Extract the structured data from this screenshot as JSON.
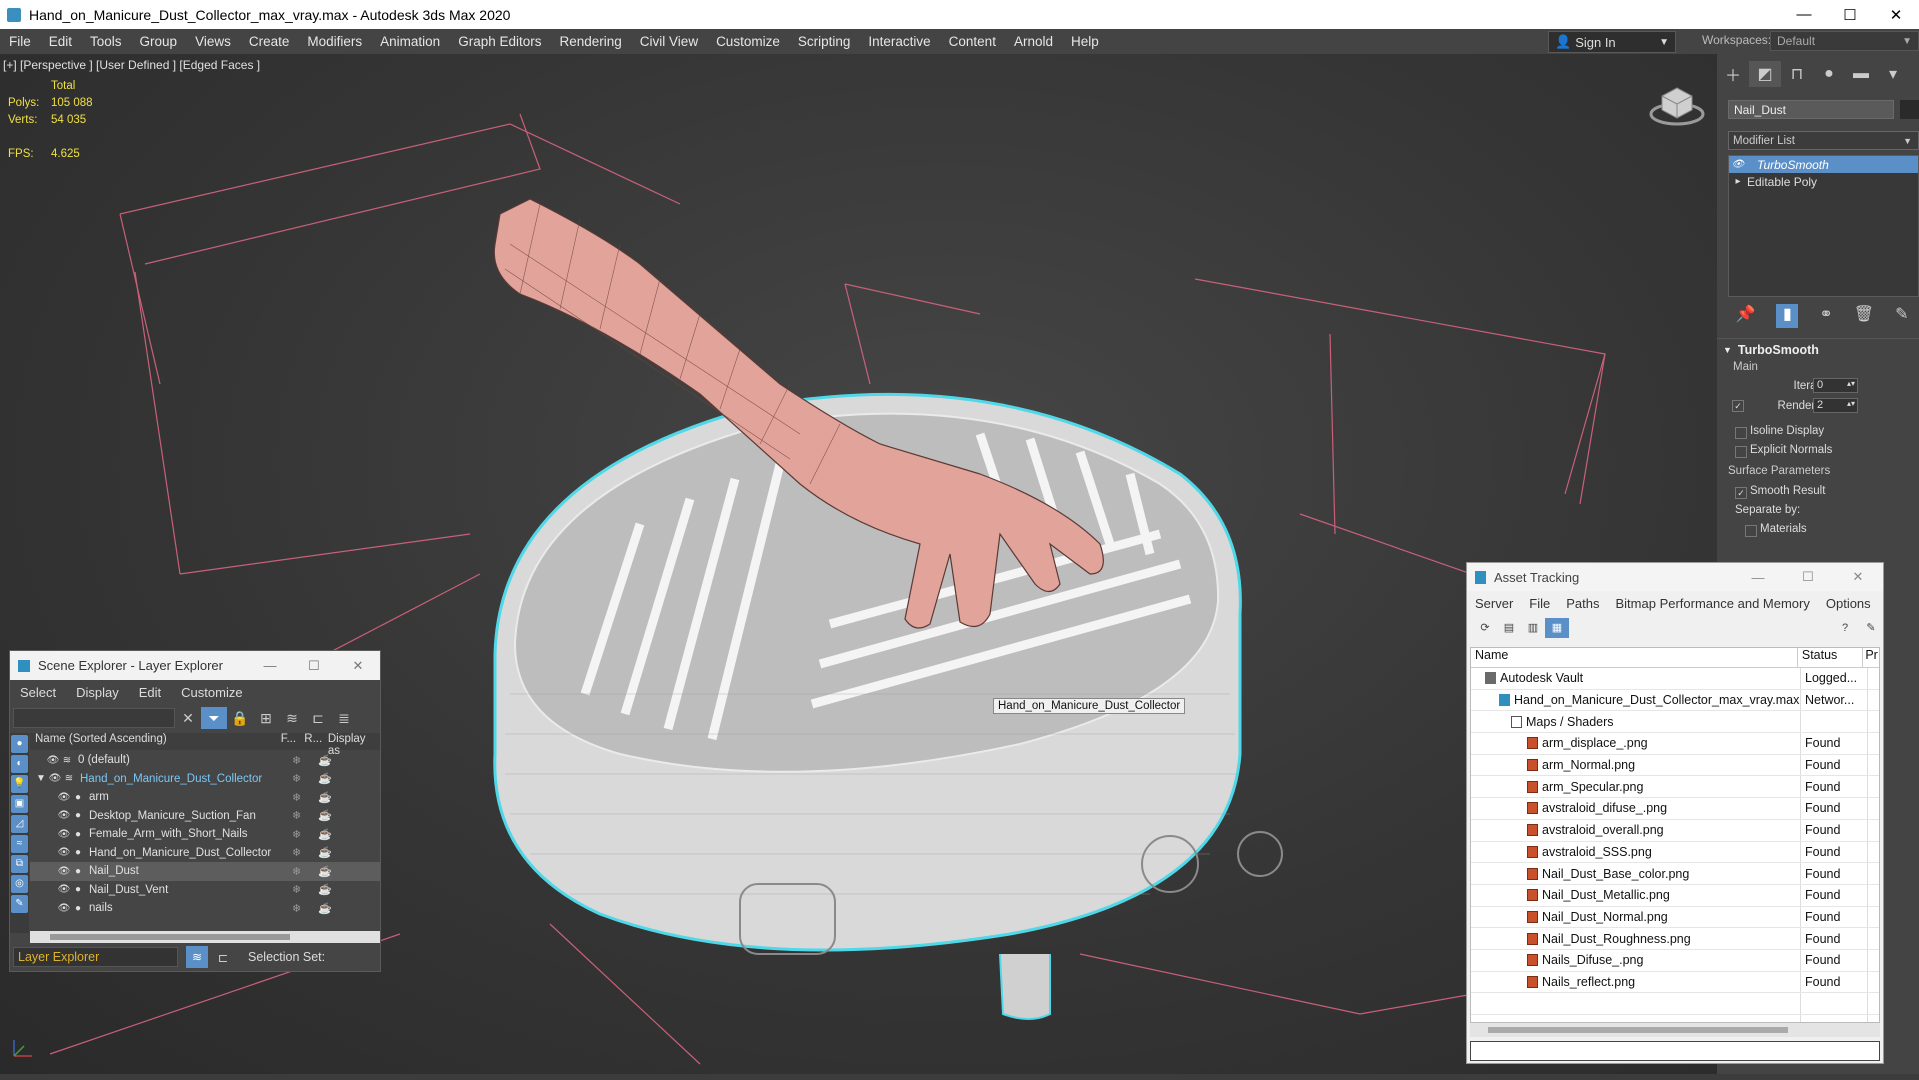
{
  "window": {
    "title": "Hand_on_Manicure_Dust_Collector_max_vray.max - Autodesk 3ds Max 2020",
    "minimize": "—",
    "maximize": "☐",
    "close": "✕"
  },
  "menu": [
    "File",
    "Edit",
    "Tools",
    "Group",
    "Views",
    "Create",
    "Modifiers",
    "Animation",
    "Graph Editors",
    "Rendering",
    "Civil View",
    "Customize",
    "Scripting",
    "Interactive",
    "Content",
    "Arnold",
    "Help"
  ],
  "signin": {
    "label": "Sign In"
  },
  "workspaces": {
    "label": "Workspaces:",
    "value": "Default"
  },
  "viewport": {
    "label": "[+] [Perspective ] [User Defined ] [Edged Faces ]",
    "stats": {
      "header": "Total",
      "polys_label": "Polys:",
      "polys": "105 088",
      "verts_label": "Verts:",
      "verts": "54 035",
      "fps_label": "FPS:",
      "fps": "4.625"
    },
    "object_tooltip": "Hand_on_Manicure_Dust_Collector"
  },
  "command_panel": {
    "object_name": "Nail_Dust",
    "modifier_list": "Modifier List",
    "stack": [
      {
        "label": "TurboSmooth",
        "selected": true
      },
      {
        "label": "Editable Poly",
        "selected": false
      }
    ],
    "turbosmooth": {
      "title": "TurboSmooth",
      "main": "Main",
      "iterations_label": "Iterations:",
      "iterations": "0",
      "render_iters_label": "Render Iters:",
      "render_iters": "2",
      "isoline": "Isoline Display",
      "explicit_normals": "Explicit Normals",
      "surface_params": "Surface Parameters",
      "smooth_result": "Smooth Result",
      "separate_by": "Separate by:",
      "materials": "Materials"
    }
  },
  "scene_explorer": {
    "title": "Scene Explorer - Layer Explorer",
    "menu": [
      "Select",
      "Display",
      "Edit",
      "Customize"
    ],
    "columns": {
      "name": "Name (Sorted Ascending)",
      "frozen": "F...",
      "render": "R...",
      "display": "Display as"
    },
    "rows": [
      {
        "name": "0 (default)",
        "indent": 1,
        "highlight": false,
        "selected": false
      },
      {
        "name": "Hand_on_Manicure_Dust_Collector",
        "indent": 0,
        "highlight": true,
        "selected": false
      },
      {
        "name": "arm",
        "indent": 2,
        "highlight": false,
        "selected": false
      },
      {
        "name": "Desktop_Manicure_Suction_Fan",
        "indent": 2,
        "highlight": false,
        "selected": false
      },
      {
        "name": "Female_Arm_with_Short_Nails",
        "indent": 2,
        "highlight": false,
        "selected": false
      },
      {
        "name": "Hand_on_Manicure_Dust_Collector",
        "indent": 2,
        "highlight": false,
        "selected": false
      },
      {
        "name": "Nail_Dust",
        "indent": 2,
        "highlight": false,
        "selected": true
      },
      {
        "name": "Nail_Dust_Vent",
        "indent": 2,
        "highlight": false,
        "selected": false
      },
      {
        "name": "nails",
        "indent": 2,
        "highlight": false,
        "selected": false
      }
    ],
    "footer": {
      "explorer": "Layer Explorer",
      "selection_set": "Selection Set:"
    }
  },
  "asset_tracking": {
    "title": "Asset Tracking",
    "menu": [
      "Server",
      "File",
      "Paths",
      "Bitmap Performance and Memory",
      "Options"
    ],
    "columns": {
      "name": "Name",
      "status": "Status",
      "proxy": "Pr"
    },
    "rows": [
      {
        "name": "Autodesk Vault",
        "status": "Logged...",
        "type": "vault",
        "indent": 1
      },
      {
        "name": "Hand_on_Manicure_Dust_Collector_max_vray.max",
        "status": "Networ...",
        "type": "max",
        "indent": 2
      },
      {
        "name": "Maps / Shaders",
        "status": "",
        "type": "fold",
        "indent": 3
      },
      {
        "name": "arm_displace_.png",
        "status": "Found",
        "type": "img",
        "indent": 4
      },
      {
        "name": "arm_Normal.png",
        "status": "Found",
        "type": "img",
        "indent": 4
      },
      {
        "name": "arm_Specular.png",
        "status": "Found",
        "type": "img",
        "indent": 4
      },
      {
        "name": "avstraloid_difuse_.png",
        "status": "Found",
        "type": "img",
        "indent": 4
      },
      {
        "name": "avstraloid_overall.png",
        "status": "Found",
        "type": "img",
        "indent": 4
      },
      {
        "name": "avstraloid_SSS.png",
        "status": "Found",
        "type": "img",
        "indent": 4
      },
      {
        "name": "Nail_Dust_Base_color.png",
        "status": "Found",
        "type": "img",
        "indent": 4
      },
      {
        "name": "Nail_Dust_Metallic.png",
        "status": "Found",
        "type": "img",
        "indent": 4
      },
      {
        "name": "Nail_Dust_Normal.png",
        "status": "Found",
        "type": "img",
        "indent": 4
      },
      {
        "name": "Nail_Dust_Roughness.png",
        "status": "Found",
        "type": "img",
        "indent": 4
      },
      {
        "name": "Nails_Difuse_.png",
        "status": "Found",
        "type": "img",
        "indent": 4
      },
      {
        "name": "Nails_reflect.png",
        "status": "Found",
        "type": "img",
        "indent": 4
      }
    ]
  },
  "colors": {
    "accent": "#5a8fc8",
    "selection_outline": "#4fd8e8",
    "grid": "#d06080",
    "stats": "#f0e040"
  }
}
